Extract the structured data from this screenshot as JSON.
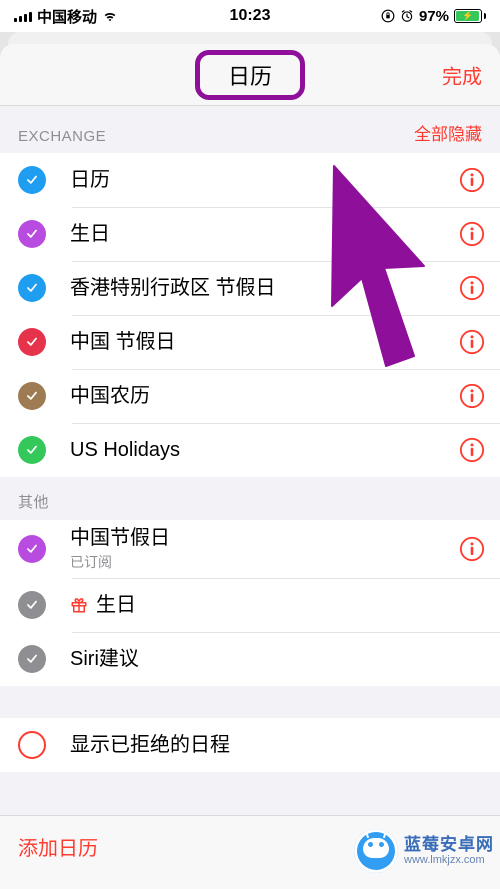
{
  "status": {
    "carrier": "中国移动",
    "time": "10:23",
    "battery_pct": "97%"
  },
  "header": {
    "title": "日历",
    "done_label": "完成"
  },
  "sections": [
    {
      "key": "exchange",
      "title": "EXCHANGE",
      "action_label": "全部隐藏",
      "items": [
        {
          "label": "日历",
          "color": "#1e9df1",
          "checked": true,
          "info": true
        },
        {
          "label": "生日",
          "color": "#b84ce0",
          "checked": true,
          "info": true
        },
        {
          "label": "香港特别行政区 节假日",
          "color": "#1e9df1",
          "checked": true,
          "info": true
        },
        {
          "label": "中国 节假日",
          "color": "#e6324b",
          "checked": true,
          "info": true
        },
        {
          "label": "中国农历",
          "color": "#9e7b52",
          "checked": true,
          "info": true
        },
        {
          "label": "US Holidays",
          "color": "#34c759",
          "checked": true,
          "info": true
        }
      ]
    },
    {
      "key": "other",
      "title": "其他",
      "items": [
        {
          "label": "中国节假日",
          "sub": "已订阅",
          "color": "#b84ce0",
          "checked": true,
          "info": true
        },
        {
          "label": "生日",
          "color": "#8e8e93",
          "checked": true,
          "info": false,
          "icon": "gift"
        },
        {
          "label": "Siri建议",
          "color": "#8e8e93",
          "checked": true,
          "info": false
        }
      ]
    },
    {
      "key": "declined",
      "items": [
        {
          "label": "显示已拒绝的日程",
          "color": "#ff3b30",
          "checked": false,
          "info": false,
          "style": "empty"
        }
      ]
    }
  ],
  "footer": {
    "add_label": "添加日历"
  },
  "watermark": {
    "brand": "蓝莓安卓网",
    "url": "www.lmkjzx.com"
  },
  "annotation": {
    "type": "arrow-cursor",
    "color": "#8e0f9a"
  }
}
